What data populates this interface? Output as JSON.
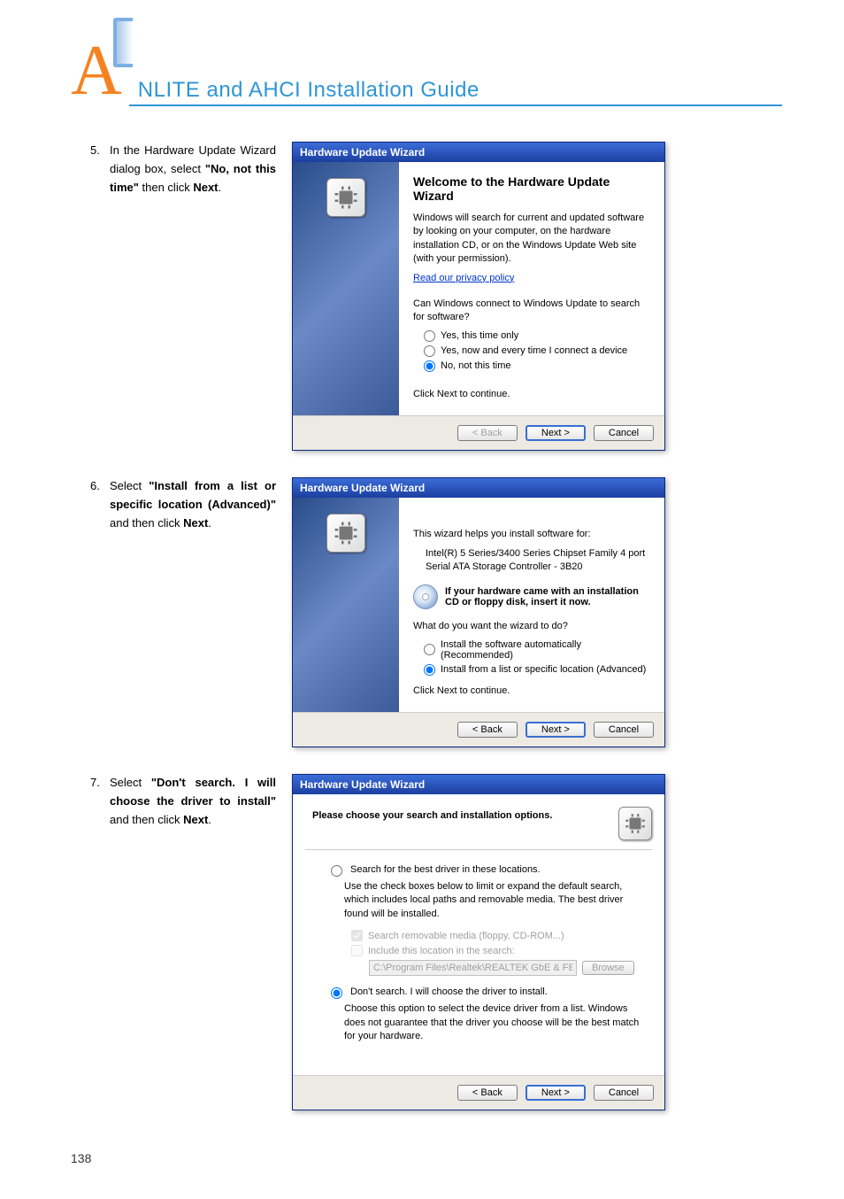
{
  "header": {
    "letter": "A",
    "title": "NLITE and AHCI Installation Guide"
  },
  "steps": {
    "s5": {
      "num": "5.",
      "text_pre": "In the Hardware Update Wizard dialog box, select ",
      "bold1": "\"No, not this time\"",
      "text_mid": " then click ",
      "bold2": "Next",
      "text_post": "."
    },
    "s6": {
      "num": "6.",
      "text_pre": "Select ",
      "bold1": "\"Install from a list or specific location (Advanced)\"",
      "text_mid": " and then click ",
      "bold2": "Next",
      "text_post": "."
    },
    "s7": {
      "num": "7.",
      "text_pre": "Select ",
      "bold1": "\"Don't search. I will choose the driver to install\"",
      "text_mid": " and then click ",
      "bold2": "Next",
      "text_post": "."
    }
  },
  "wiz_common": {
    "titlebar": "Hardware Update Wizard",
    "btn_back": "< Back",
    "btn_next": "Next >",
    "btn_cancel": "Cancel"
  },
  "wiz5": {
    "heading": "Welcome to the Hardware Update Wizard",
    "p1": "Windows will search for current and updated software by looking on your computer, on the hardware installation CD, or on the Windows Update Web site (with your permission).",
    "link": "Read our privacy policy",
    "p2": "Can Windows connect to Windows Update to search for software?",
    "r1": "Yes, this time only",
    "r2": "Yes, now and every time I connect a device",
    "r3": "No, not this time",
    "cont": "Click Next to continue."
  },
  "wiz6": {
    "p1": "This wizard helps you install software for:",
    "device": "Intel(R) 5 Series/3400 Series Chipset Family 4 port Serial ATA Storage Controller - 3B20",
    "cd_bold": "If your hardware came with an installation CD or floppy disk, insert it now.",
    "q": "What do you want the wizard to do?",
    "r1": "Install the software automatically (Recommended)",
    "r2": "Install from a list or specific location (Advanced)",
    "cont": "Click Next to continue."
  },
  "wiz7": {
    "subhead": "Please choose your search and installation options.",
    "r1": "Search for the best driver in these locations.",
    "r1desc": "Use the check boxes below to limit or expand the default search, which includes local paths and removable media. The best driver found will be installed.",
    "chk1": "Search removable media (floppy, CD-ROM...)",
    "chk2": "Include this location in the search:",
    "path": "C:\\Program Files\\Realtek\\REALTEK GbE & FE Ether",
    "browse": "Browse",
    "r2": "Don't search. I will choose the driver to install.",
    "r2desc": "Choose this option to select the device driver from a list.  Windows does not guarantee that the driver you choose will be the best match for your hardware."
  },
  "page_number": "138"
}
